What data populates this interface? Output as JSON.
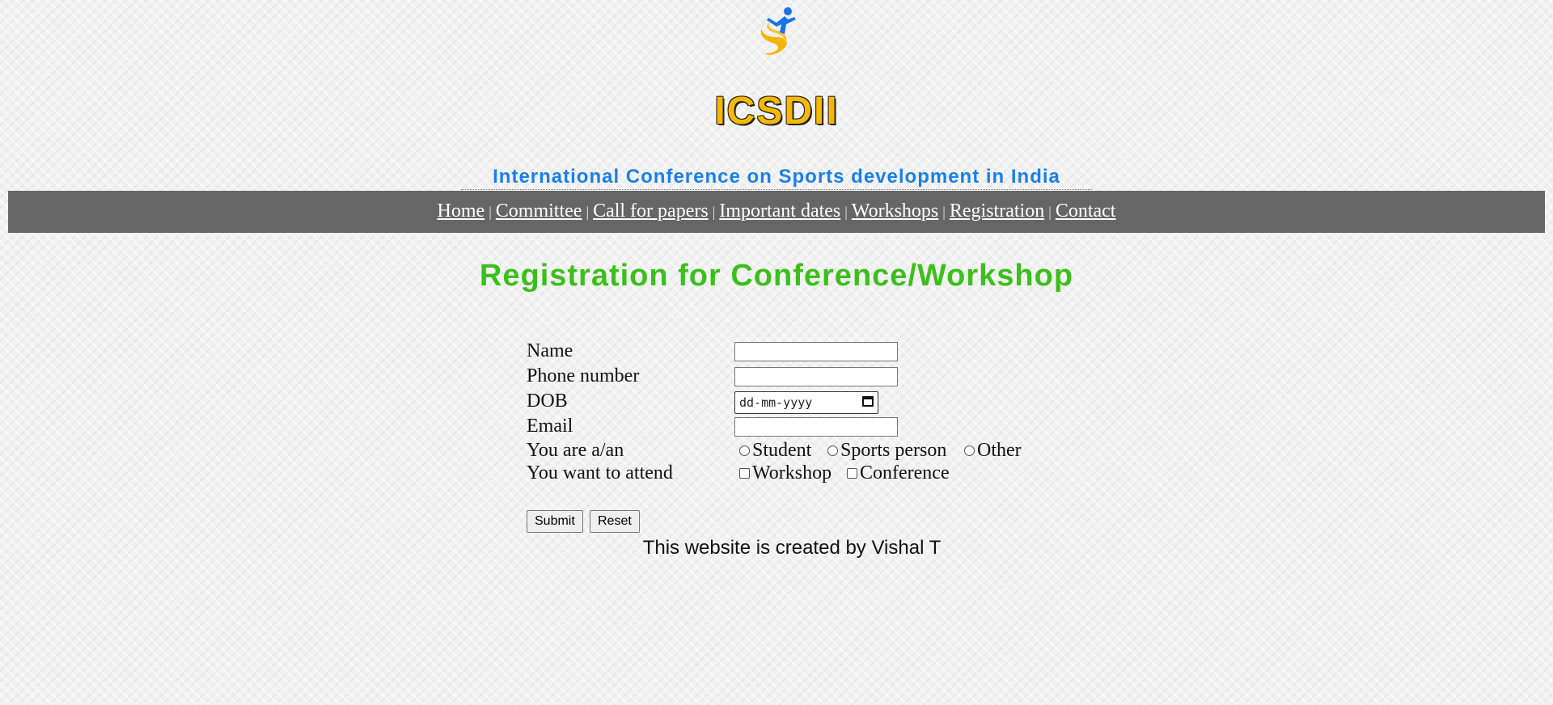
{
  "header": {
    "logo_icon": "sports-runner-logo",
    "title": "ICSDII",
    "subtitle": "International Conference on Sports development in India"
  },
  "nav": {
    "items": [
      {
        "label": "Home"
      },
      {
        "label": "Committee"
      },
      {
        "label": "Call for papers"
      },
      {
        "label": "Important dates"
      },
      {
        "label": "Workshops"
      },
      {
        "label": "Registration"
      },
      {
        "label": "Contact"
      }
    ],
    "separator": "|"
  },
  "main": {
    "heading": "Registration for Conference/Workshop"
  },
  "form": {
    "name_label": "Name",
    "name_value": "",
    "phone_label": "Phone number",
    "phone_value": "",
    "dob_label": "DOB",
    "dob_placeholder": "dd-mm-yyyy",
    "email_label": "Email",
    "email_value": "",
    "role_label": "You are a/an",
    "role_options": [
      "Student",
      "Sports person",
      "Other"
    ],
    "attend_label": "You want to attend",
    "attend_options": [
      "Workshop",
      "Conference"
    ],
    "submit_label": "Submit",
    "reset_label": "Reset"
  },
  "footer": {
    "text": "This website is created by Vishal T"
  },
  "colors": {
    "title": "#f6b800",
    "subtitle": "#1a7fe8",
    "nav_bg": "#666666",
    "heading": "#3cbf1d"
  }
}
